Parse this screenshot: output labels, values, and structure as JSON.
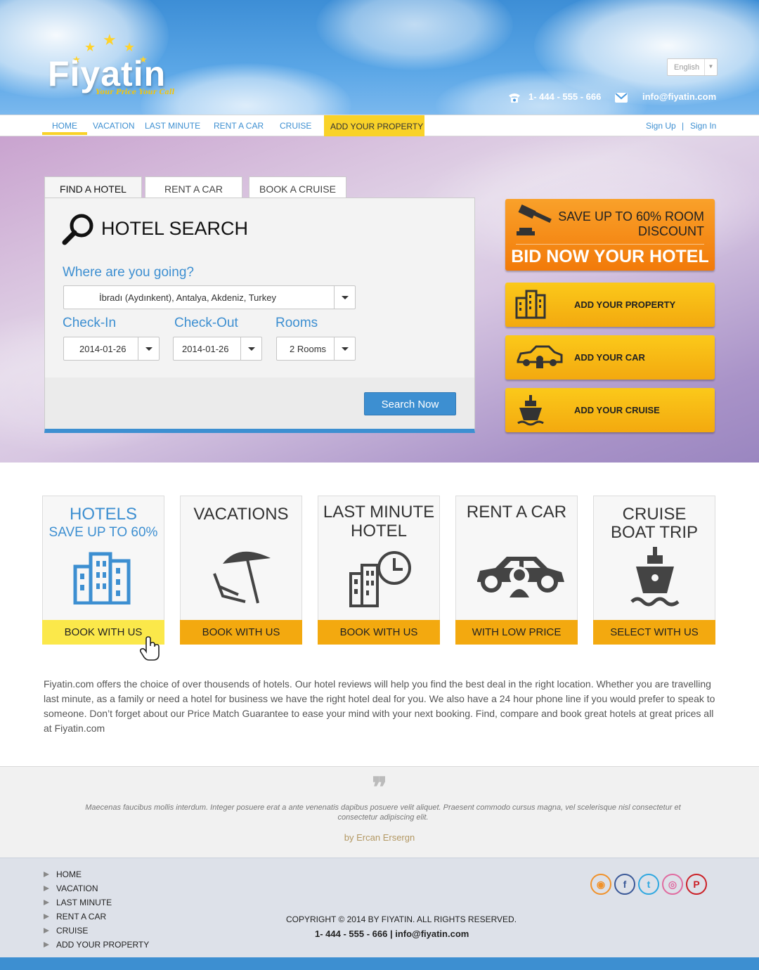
{
  "brand": {
    "name": "Fiyatin",
    "tagline": "Your Price Your Call"
  },
  "header": {
    "language": "English",
    "phone": "1- 444 - 555 - 666",
    "email": "info@fiyatin.com"
  },
  "nav": {
    "items": [
      "HOME",
      "VACATION",
      "LAST MINUTE",
      "RENT A CAR",
      "CRUISE",
      "ADD YOUR PROPERTY"
    ],
    "signup": "Sign Up",
    "separator": "|",
    "signin": "Sign In"
  },
  "search": {
    "tabs": [
      "FIND A HOTEL",
      "RENT A CAR",
      "BOOK A CRUISE"
    ],
    "title": "HOTEL SEARCH",
    "destination_label": "Where are you going?",
    "destination_value": "İbradı (Aydınkent), Antalya, Akdeniz, Turkey",
    "checkin_label": "Check-In",
    "checkin_value": "2014-01-26",
    "checkout_label": "Check-Out",
    "checkout_value": "2014-01-26",
    "rooms_label": "Rooms",
    "rooms_value": "2 Rooms",
    "button": "Search Now"
  },
  "promo": {
    "bid_line1": "SAVE UP TO 60% ROOM",
    "bid_line2": "DISCOUNT",
    "bid_cta": "BID NOW YOUR HOTEL",
    "add_property": "ADD YOUR PROPERTY",
    "add_car": "ADD YOUR CAR",
    "add_cruise": "ADD YOUR CRUISE"
  },
  "cards": [
    {
      "title1": "HOTELS",
      "title2": "SAVE UP TO 60%",
      "button": "BOOK WITH US",
      "icon": "hotel-building-icon"
    },
    {
      "title1": "VACATIONS",
      "title2": "",
      "button": "BOOK WITH US",
      "icon": "beach-umbrella-icon"
    },
    {
      "title1": "LAST MINUTE",
      "title2": "HOTEL",
      "button": "BOOK WITH US",
      "icon": "building-clock-icon"
    },
    {
      "title1": "RENT A CAR",
      "title2": "",
      "button": "WITH LOW PRICE",
      "icon": "car-icon"
    },
    {
      "title1": "CRUISE",
      "title2": "BOAT TRIP",
      "button": "SELECT WITH US",
      "icon": "ship-icon"
    }
  ],
  "description": "Fiyatin.com offers the choice of over thousends of  hotels. Our hotel reviews will help you find the best deal in the right location. Whether you are travelling last minute, as a family or need a hotel for business we have the right hotel deal for you. We also have a 24 hour phone line if you would prefer to speak to someone. Don’t forget about our Price Match Guarantee to ease your mind with your next booking. Find, compare and book great hotels at great prices all at Fiyatin.com",
  "testimonial": {
    "quote": "Maecenas faucibus mollis interdum. Integer posuere erat a ante venenatis dapibus posuere velit aliquet. Praesent commodo cursus magna, vel scelerisque nisl consectetur et consectetur adipiscing elit.",
    "author": "by Ercan Ersergn"
  },
  "footer": {
    "links": [
      "HOME",
      "VACATION",
      "LAST MINUTE",
      "RENT A CAR",
      "CRUISE",
      "ADD YOUR PROPERTY"
    ],
    "copyright": "COPYRIGHT © 2014 BY FIYATIN. ALL RIGHTS RESERVED.",
    "contact": "1- 444 - 555 - 666  | info@fiyatin.com",
    "social": [
      "rss-icon",
      "facebook-icon",
      "twitter-icon",
      "dribbble-icon",
      "pinterest-icon"
    ]
  },
  "colors": {
    "primary": "#3d8fd1",
    "accent_yellow": "#f9d228",
    "accent_orange": "#f3a90f",
    "bid_orange": "#f27a09"
  }
}
